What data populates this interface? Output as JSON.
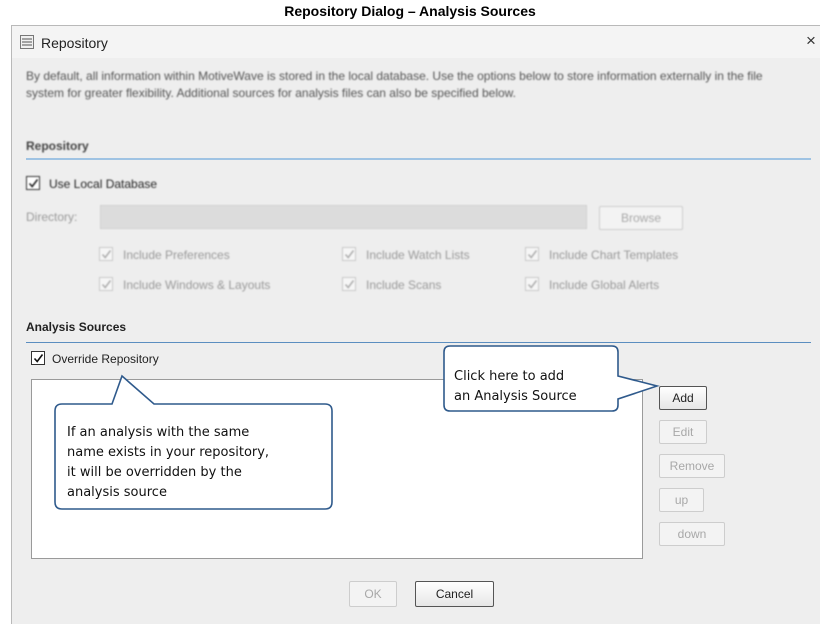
{
  "caption": "Repository Dialog – Analysis Sources",
  "window": {
    "title": "Repository",
    "close_glyph": "×",
    "icon": "repository-icon"
  },
  "description": "By default, all information within MotiveWave is stored in the local database. Use the options below to store information externally in the file system for greater flexibility. Additional sources for analysis files can also be specified below.",
  "repository_section": {
    "heading": "Repository",
    "use_local_database": {
      "label": "Use Local Database",
      "checked": true
    },
    "directory_label": "Directory:",
    "directory_value": "",
    "browse_label": "Browse",
    "includes": [
      {
        "label": "Include Preferences",
        "checked": true
      },
      {
        "label": "Include Watch Lists",
        "checked": true
      },
      {
        "label": "Include Chart Templates",
        "checked": true
      },
      {
        "label": "Include Windows & Layouts",
        "checked": true
      },
      {
        "label": "Include Scans",
        "checked": true
      },
      {
        "label": "Include Global Alerts",
        "checked": true
      }
    ]
  },
  "analysis_section": {
    "heading": "Analysis Sources",
    "override": {
      "label": "Override Repository",
      "checked": true
    },
    "buttons": {
      "add": "Add",
      "edit": "Edit",
      "remove": "Remove",
      "up": "up",
      "down": "down"
    }
  },
  "callouts": {
    "add_hint": [
      "Click here to add",
      "an Analysis Source"
    ],
    "override_hint": [
      "If an analysis with the same",
      "name exists in your repository,",
      "it will be overridden by the",
      "analysis source"
    ]
  },
  "footer": {
    "ok": "OK",
    "cancel": "Cancel"
  },
  "colors": {
    "accent_rule": "#9fc3e3",
    "callout_border": "#2f5a8c"
  }
}
